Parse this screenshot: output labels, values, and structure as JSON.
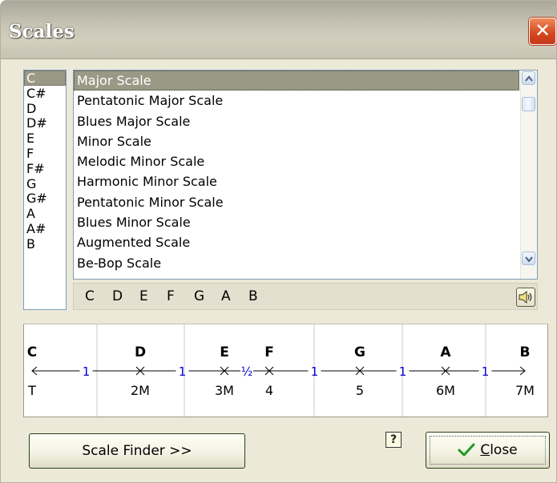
{
  "window": {
    "title": "Scales",
    "close_glyph": "✕",
    "title_color": "#ffffff",
    "close_color": "#d6461f",
    "selection_color": "#9a9986"
  },
  "key_list": {
    "items": [
      "C",
      "C#",
      "D",
      "D#",
      "E",
      "F",
      "F#",
      "G",
      "G#",
      "A",
      "A#",
      "B"
    ],
    "selected_index": 0
  },
  "scale_list": {
    "items": [
      "Major Scale",
      "Pentatonic Major Scale",
      "Blues Major Scale",
      "Minor Scale",
      "Melodic Minor Scale",
      "Harmonic Minor Scale",
      "Pentatonic Minor Scale",
      "Blues Minor Scale",
      "Augmented Scale",
      "Be-Bop Scale"
    ],
    "selected_index": 0
  },
  "scale_notes": [
    "C",
    "D",
    "E",
    "F",
    "G",
    "A",
    "B"
  ],
  "speaker": {
    "icon": "speaker-icon"
  },
  "diagram": {
    "notes": [
      "C",
      "D",
      "E",
      "F",
      "G",
      "A",
      "B"
    ],
    "steps": [
      "1",
      "1",
      "½",
      "1",
      "1",
      "1"
    ],
    "degrees": [
      "T",
      "2M",
      "3M",
      "4",
      "5",
      "6M",
      "7M"
    ],
    "step_color": "#0000cc"
  },
  "buttons": {
    "scale_finder": "Scale Finder  >>",
    "close_underline": "C",
    "close_rest": "lose",
    "help": "?",
    "check_color": "#1f9a1f"
  }
}
